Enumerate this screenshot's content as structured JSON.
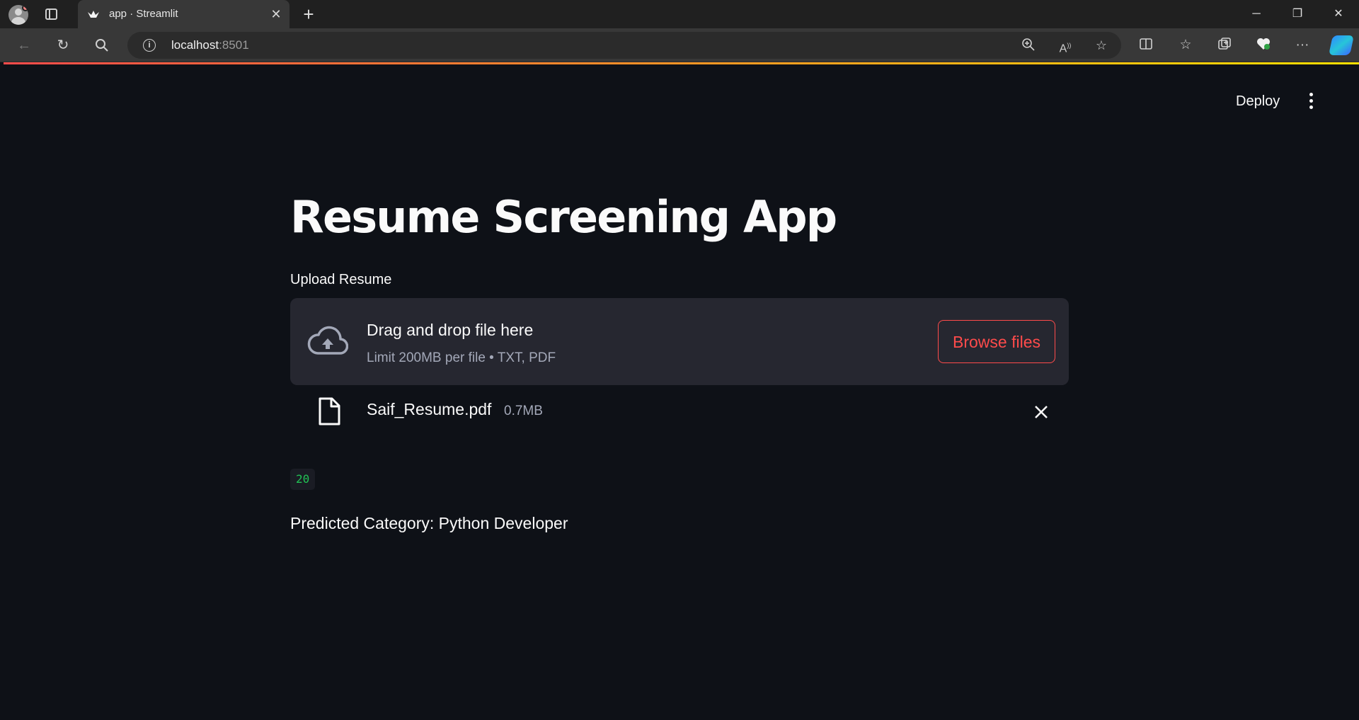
{
  "browser": {
    "tab_title": "app · Streamlit",
    "url_host": "localhost",
    "url_port": ":8501"
  },
  "app": {
    "deploy_label": "Deploy",
    "title": "Resume Screening App",
    "uploader": {
      "label": "Upload Resume",
      "drop_text": "Drag and drop file here",
      "limit_text": "Limit 200MB per file • TXT, PDF",
      "browse_label": "Browse files"
    },
    "uploaded_file": {
      "name": "Saif_Resume.pdf",
      "size": "0.7MB"
    },
    "code_output": "20",
    "prediction": "Predicted Category: Python Developer"
  },
  "colors": {
    "background": "#0e1117",
    "accent": "#ff4b4b",
    "dropzone": "#262730",
    "code_text": "#21c354"
  },
  "icons": [
    "profile-icon",
    "tab-actions-icon",
    "streamlit-favicon",
    "close-icon",
    "new-tab-icon",
    "minimize-icon",
    "restore-icon",
    "window-close-icon",
    "back-icon",
    "refresh-icon",
    "search-icon",
    "info-icon",
    "zoom-icon",
    "read-aloud-icon",
    "favorite-star-icon",
    "split-screen-icon",
    "favorites-icon",
    "collections-icon",
    "browser-essentials-icon",
    "more-icon",
    "copilot-icon",
    "kebab-menu-icon",
    "cloud-upload-icon",
    "file-icon",
    "remove-file-icon"
  ]
}
